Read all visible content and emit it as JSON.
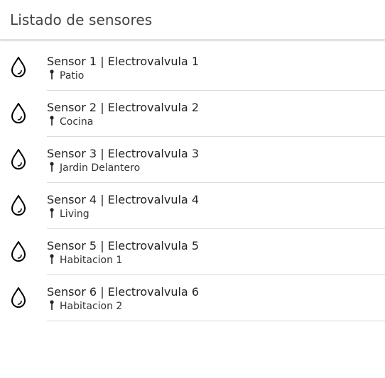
{
  "toolbar": {
    "title": "Listado de sensores"
  },
  "sensors": [
    {
      "title": "Sensor 1 | Electrovalvula 1",
      "icon": "water-drop-icon",
      "location_icon": "pin-icon",
      "location": "Patio"
    },
    {
      "title": "Sensor 2 | Electrovalvula 2",
      "icon": "water-drop-icon",
      "location_icon": "pin-icon",
      "location": "Cocina"
    },
    {
      "title": "Sensor 3 | Electrovalvula 3",
      "icon": "water-drop-icon",
      "location_icon": "pin-icon",
      "location": "Jardin Delantero"
    },
    {
      "title": "Sensor 4 | Electrovalvula 4",
      "icon": "water-drop-icon",
      "location_icon": "pin-icon",
      "location": "Living"
    },
    {
      "title": "Sensor 5 | Electrovalvula 5",
      "icon": "water-drop-icon",
      "location_icon": "pin-icon",
      "location": "Habitacion 1"
    },
    {
      "title": "Sensor 6 | Electrovalvula 6",
      "icon": "water-drop-icon",
      "location_icon": "pin-icon",
      "location": "Habitacion 2"
    }
  ]
}
